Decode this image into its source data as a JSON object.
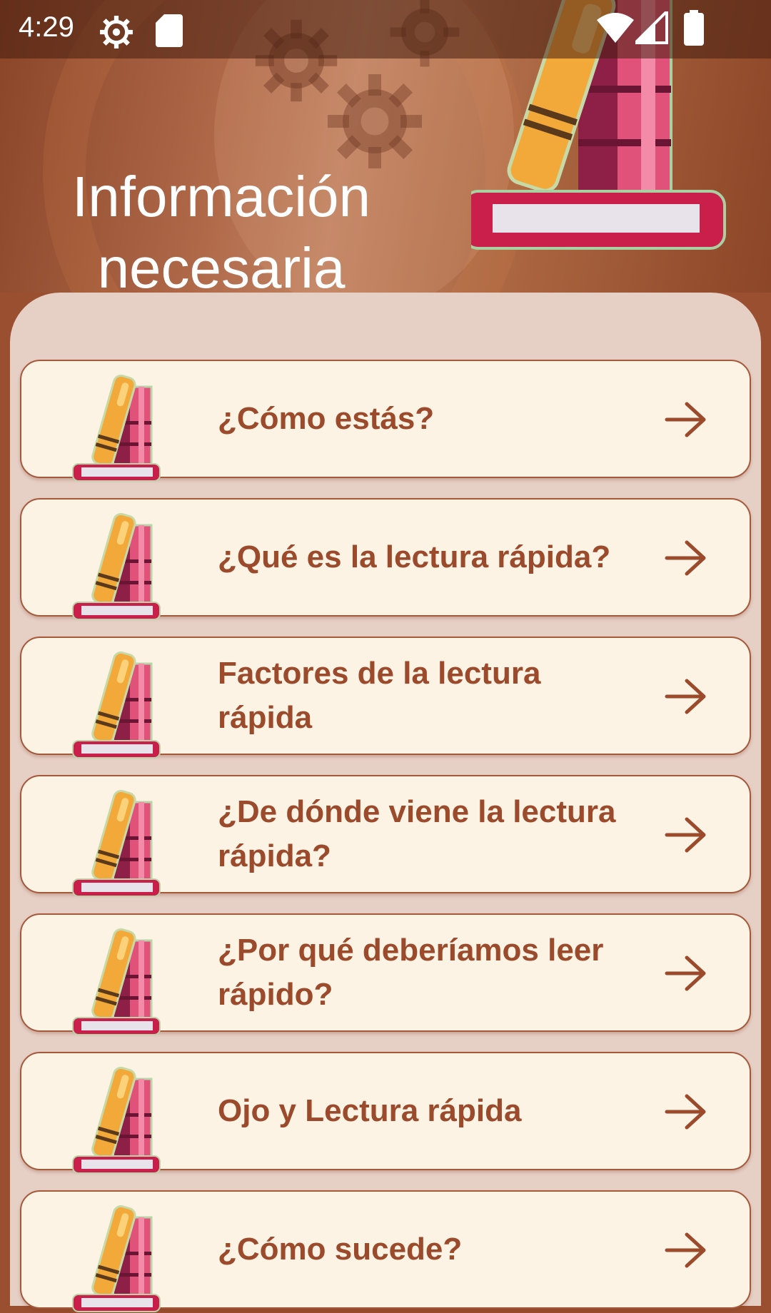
{
  "status_bar": {
    "time": "4:29",
    "icons": [
      "settings-gear-icon",
      "sd-card-icon",
      "wifi-icon",
      "cell-signal-icon",
      "battery-icon"
    ]
  },
  "header": {
    "title": "Información necesaria"
  },
  "menu": {
    "items": [
      {
        "label": "¿Cómo estás?"
      },
      {
        "label": "¿Qué es la lectura rápida?"
      },
      {
        "label": "Factores de la lectura rápida"
      },
      {
        "label": "¿De dónde viene la lectura rápida?"
      },
      {
        "label": "¿Por qué deberíamos leer rápido?"
      },
      {
        "label": "Ojo y Lectura rápida"
      },
      {
        "label": "¿Cómo sucede?"
      }
    ]
  },
  "colors": {
    "brown": "#9a4f30",
    "panel": "#e6cfc5",
    "card": "#fdf3e4",
    "text": "#9b4a2c"
  }
}
